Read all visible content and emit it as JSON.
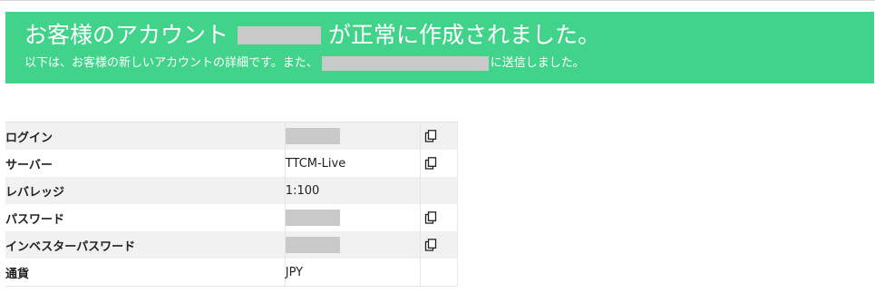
{
  "colors": {
    "banner_bg": "#42d38b",
    "redaction": "#c9c9c9"
  },
  "banner": {
    "title_before": "お客様のアカウント",
    "title_after": "が正常に作成されました。",
    "subtitle_before": "以下は、お客様の新しいアカウントの詳細です。また、",
    "subtitle_after": "に送信しました。"
  },
  "details": {
    "rows": [
      {
        "label": "ログイン",
        "value": "",
        "redacted": true,
        "copy": true
      },
      {
        "label": "サーバー",
        "value": "TTCM-Live",
        "redacted": false,
        "copy": true
      },
      {
        "label": "レバレッジ",
        "value": "1:100",
        "redacted": false,
        "copy": false
      },
      {
        "label": "パスワード",
        "value": "",
        "redacted": true,
        "copy": true
      },
      {
        "label": "インベスターパスワード",
        "value": "",
        "redacted": true,
        "copy": true
      },
      {
        "label": "通貨",
        "value": "JPY",
        "redacted": false,
        "copy": false
      }
    ],
    "copy_icon": "copy-icon"
  }
}
